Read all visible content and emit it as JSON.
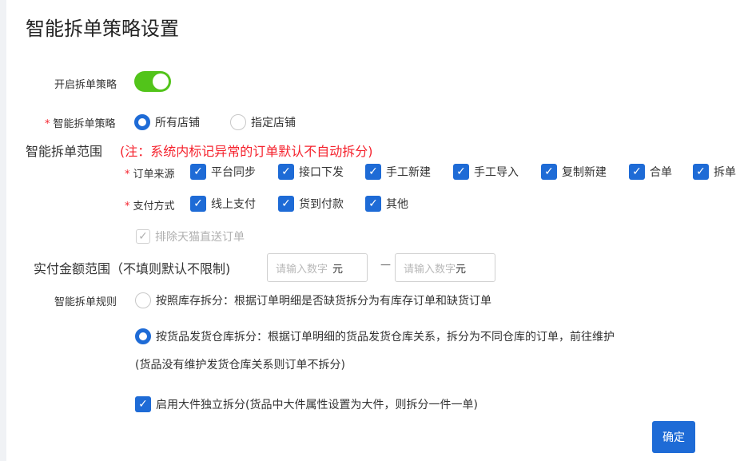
{
  "page": {
    "title": "智能拆单策略设置"
  },
  "enable": {
    "label": "开启拆单策略",
    "on": true
  },
  "strategy": {
    "label": "智能拆单策略",
    "required_mark": "*",
    "options": [
      "所有店铺",
      "指定店铺"
    ],
    "selected": "所有店铺"
  },
  "scope": {
    "title": "智能拆单范围",
    "note": "(注：系统内标记异常的订单默认不自动拆分)"
  },
  "order_source": {
    "label": "订单来源",
    "required_mark": "*",
    "options": [
      "平台同步",
      "接口下发",
      "手工新建",
      "手工导入",
      "复制新建",
      "合单",
      "拆单"
    ],
    "checked": [
      true,
      true,
      true,
      true,
      true,
      true,
      true
    ]
  },
  "payment": {
    "label": "支付方式",
    "required_mark": "*",
    "options": [
      "线上支付",
      "货到付款",
      "其他"
    ],
    "checked": [
      true,
      true,
      true
    ]
  },
  "exclude_tmall": {
    "label": "排除天猫直送订单",
    "checked": true,
    "disabled": true
  },
  "amount": {
    "label": "实付金额范围（不填则默认不限制)",
    "min_placeholder": "请输入数字",
    "max_placeholder": "请输入数字",
    "unit": "元",
    "separator": "—"
  },
  "rules": {
    "label": "智能拆单规则",
    "option1": "按照库存拆分：根据订单明细是否缺货拆分为有库存订单和缺货订单",
    "option2": "按货品发货仓库拆分：根据订单明细的货品发货仓库关系，拆分为不同仓库的订单，前往维护",
    "option2_note": "(货品没有维护发货仓库关系则订单不拆分)",
    "selected": 2,
    "bulky": {
      "label": "启用大件独立拆分(货品中大件属性设置为大件，则拆分一件一单)",
      "checked": true
    }
  },
  "actions": {
    "confirm": "确定"
  },
  "colors": {
    "primary": "#1e6bd6",
    "toggle_on": "#52c41a",
    "danger": "#f5222d"
  }
}
